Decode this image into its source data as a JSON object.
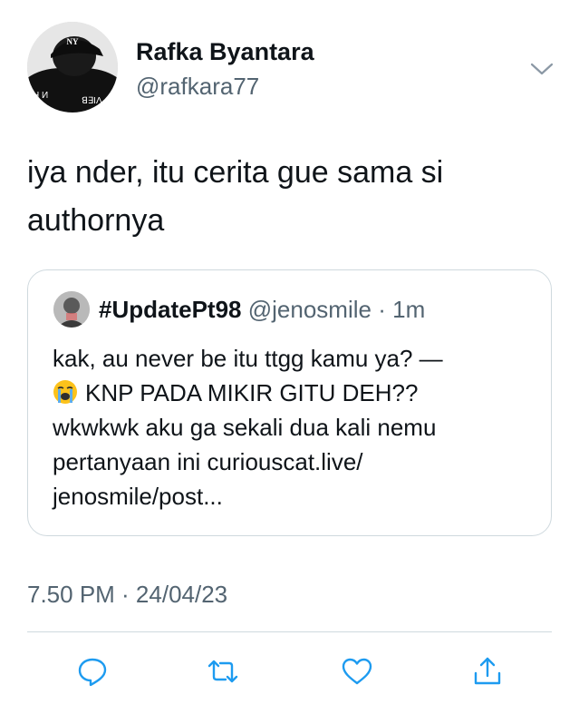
{
  "author": {
    "name": "Rafka Byantara",
    "handle": "@rafkara77",
    "avatar_cap_logo": "NY",
    "avatar_shirt_text_left": "H И",
    "avatar_shirt_text_right": "ꓭ∃IΛ"
  },
  "tweet": {
    "text_line1": "iya nder, itu cerita gue sama si",
    "text_line2": "authornya"
  },
  "quote": {
    "name": "#UpdatePt98",
    "handle": "@jenosmile",
    "separator": "·",
    "time": "1m",
    "lines": [
      "kak, au never be itu ttgg kamu ya? —",
      "KNP PADA MIKIR GITU DEH??",
      "wkwkwk aku ga sekali dua kali nemu",
      "pertanyaan ini curiouscat.live/",
      "jenosmile/post..."
    ],
    "emoji_icon": "loudly-crying-face-emoji"
  },
  "meta": {
    "timestamp": "7.50 PM · 24/04/23"
  },
  "colors": {
    "text": "#0f1419",
    "secondary": "#536471",
    "border": "#cfd9de",
    "icon": "#1d9bf0"
  },
  "actions": [
    "reply-icon",
    "retweet-icon",
    "like-icon",
    "share-icon"
  ]
}
